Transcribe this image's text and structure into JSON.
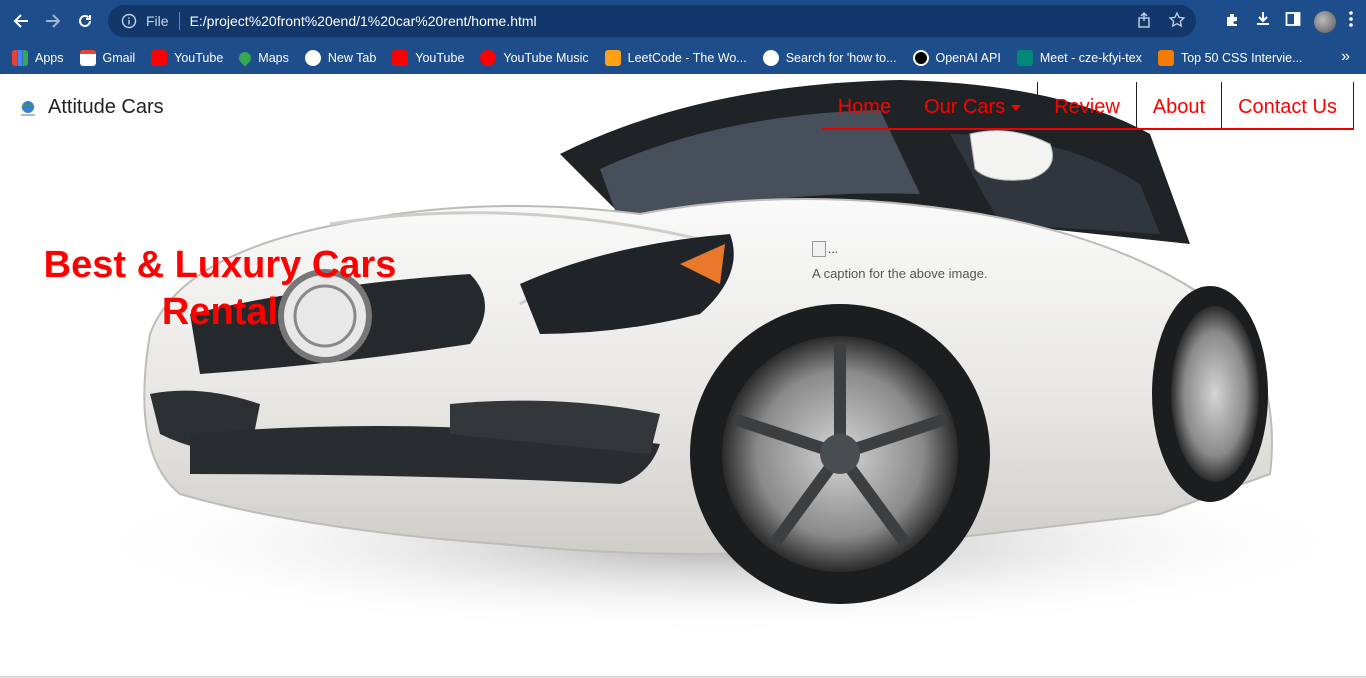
{
  "browser": {
    "address": {
      "scheme_label": "File",
      "url": "E:/project%20front%20end/1%20car%20rent/home.html"
    },
    "bookmarks": [
      {
        "label": "Apps",
        "icon": "apps-grid-icon",
        "color": "#f4b400"
      },
      {
        "label": "Gmail",
        "icon": "gmail-icon",
        "color": "#ea4335"
      },
      {
        "label": "YouTube",
        "icon": "youtube-icon",
        "color": "#ff0000"
      },
      {
        "label": "Maps",
        "icon": "maps-icon",
        "color": "#34a853"
      },
      {
        "label": "New Tab",
        "icon": "globe-icon",
        "color": "#ffffff"
      },
      {
        "label": "YouTube",
        "icon": "youtube-icon",
        "color": "#ff0000"
      },
      {
        "label": "YouTube Music",
        "icon": "youtube-music-icon",
        "color": "#ff0000"
      },
      {
        "label": "LeetCode - The Wo...",
        "icon": "leetcode-icon",
        "color": "#ffa116"
      },
      {
        "label": "Search for 'how to...",
        "icon": "globe-icon",
        "color": "#ffffff"
      },
      {
        "label": "OpenAI API",
        "icon": "openai-icon",
        "color": "#000000"
      },
      {
        "label": "Meet - cze-kfyi-tex",
        "icon": "meet-icon",
        "color": "#00897b"
      },
      {
        "label": "Top 50 CSS Intervie...",
        "icon": "orange-site-icon",
        "color": "#f57c00"
      }
    ],
    "more_label": "»"
  },
  "site": {
    "brand_name": "Attitude Cars",
    "nav": [
      {
        "label": "Home"
      },
      {
        "label": "Our Cars",
        "has_dropdown": true
      },
      {
        "label": "Review"
      },
      {
        "label": "About"
      },
      {
        "label": "Contact Us"
      }
    ],
    "headline": "Best & Luxury Cars Rental",
    "image_alt": "...",
    "caption": "A caption for the above image.",
    "accent_color": "#ff0000"
  }
}
